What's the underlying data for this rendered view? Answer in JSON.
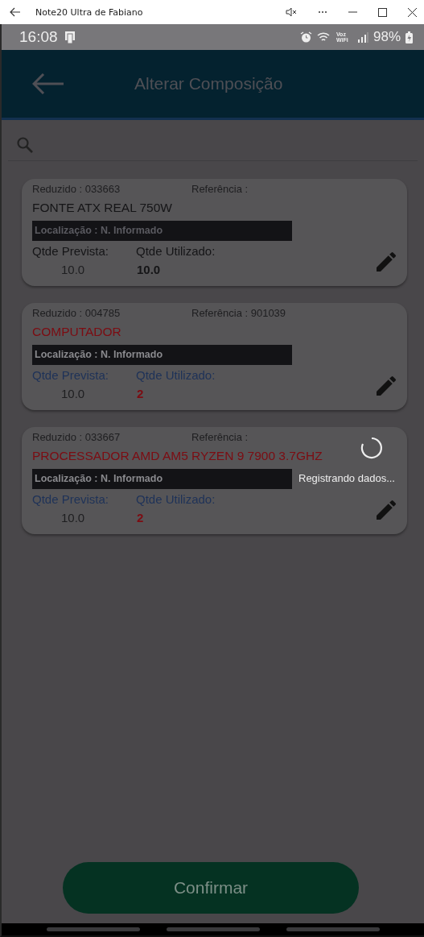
{
  "window": {
    "title": "Note20 Ultra de Fabiano"
  },
  "status_bar": {
    "time": "16:08",
    "network": "Voz WiFi",
    "battery": "98%"
  },
  "header": {
    "title": "Alterar Composição"
  },
  "items": [
    {
      "reduzido": "Reduzido : 033663",
      "referencia": "Referência :",
      "name": "FONTE ATX REAL 750W",
      "location": "Localização : N. Informado",
      "label_prevista": "Qtde Prevista:",
      "label_utilizado": "Qtde Utilizado:",
      "prevista": "10.0",
      "utilizado": "10.0",
      "pending": false
    },
    {
      "reduzido": "Reduzido : 004785",
      "referencia": "Referência : 901039",
      "name": "COMPUTADOR",
      "location": "Localização : N. Informado",
      "label_prevista": "Qtde Prevista:",
      "label_utilizado": "Qtde Utilizado:",
      "prevista": "10.0",
      "utilizado": "2",
      "pending": true
    },
    {
      "reduzido": "Reduzido : 033667",
      "referencia": "Referência :",
      "name": "PROCESSADOR AMD AM5 RYZEN 9 7900 3.7GHZ",
      "location": "Localização : N. Informado",
      "label_prevista": "Qtde Prevista:",
      "label_utilizado": "Qtde Utilizado:",
      "prevista": "10.0",
      "utilizado": "2",
      "pending": true
    }
  ],
  "loading": {
    "message": "Registrando dados..."
  },
  "confirm_button": "Confirmar"
}
